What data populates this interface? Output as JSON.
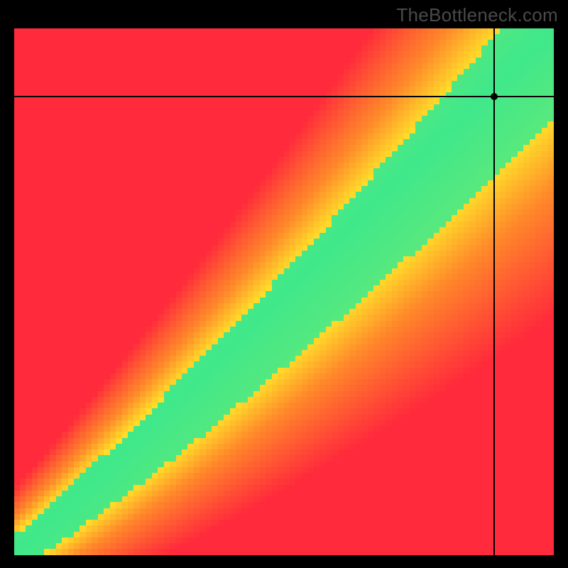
{
  "watermark": "TheBottleneck.com",
  "chart_data": {
    "type": "heatmap",
    "title": "",
    "xlabel": "",
    "ylabel": "",
    "x_range": [
      0,
      100
    ],
    "y_range": [
      0,
      100
    ],
    "grid": false,
    "legend": false,
    "optimum_curve_description": "Green optimal band roughly along diagonal, curving slightly below y=x for low values; yellow near-optimal zones surrounding it; red far from balance in both off-diagonal corners (upper-left and lower-right).",
    "crosshair": {
      "x": 89,
      "y": 87
    },
    "color_stops": {
      "red": "#ff2a3c",
      "orange": "#ff8a2a",
      "yellow": "#fff02a",
      "green": "#22e79a"
    },
    "pixelation": 90
  }
}
